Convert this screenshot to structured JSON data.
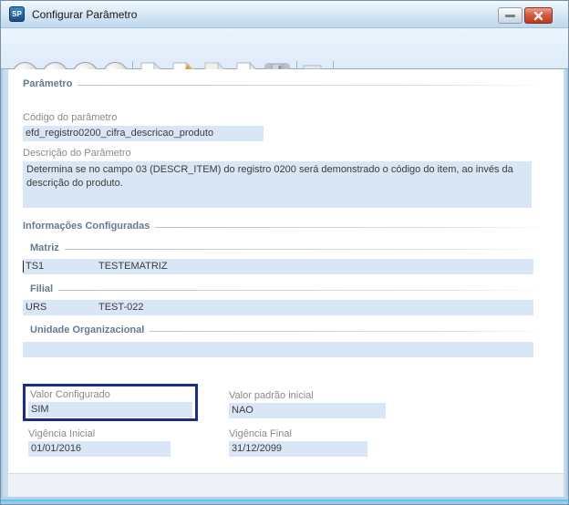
{
  "colors": {
    "annotation_box": "#1b2c90",
    "field_background": "#d9e6f5",
    "close_button_red": "#c8432c",
    "toolbar_background": "#e3eefb",
    "section_header_text": "#66798f"
  },
  "window": {
    "title": "Configurar Parâmetro",
    "icon_text": "SP"
  },
  "toolbar_icons": [
    "first-record-icon",
    "previous-record-icon",
    "next-record-icon",
    "last-record-icon",
    "new-document-icon",
    "edit-pencil-icon",
    "undo-arrow-icon",
    "cancel-red-x-icon",
    "save-floppy-icon",
    "lock-icon"
  ],
  "parametro": {
    "section_title": "Parâmetro",
    "codigo": {
      "label": "Código do parâmetro",
      "value": "efd_registro0200_cifra_descricao_produto"
    },
    "descricao": {
      "label": "Descrição do Parâmetro",
      "value": "Determina se no campo 03 (DESCR_ITEM) do registro 0200 será demonstrado o código do item, ao invés da descrição do produto."
    }
  },
  "informacoes": {
    "section_title": "Informações Configuradas",
    "matriz": {
      "title": "Matriz",
      "code": "TS1",
      "name": "TESTEMATRIZ"
    },
    "filial": {
      "title": "Filial",
      "code": "URS",
      "name": "TEST-022"
    },
    "unidade": {
      "title": "Unidade Organizacional",
      "code": "",
      "name": ""
    },
    "valor_configurado": {
      "label": "Valor Configurado",
      "value": "SIM"
    },
    "valor_padrao": {
      "label": "Valor padrão inicial",
      "value": "NAO"
    },
    "vigencia_inicial": {
      "label": "Vigência Inicial",
      "value": "01/01/2016"
    },
    "vigencia_final": {
      "label": "Vigência Final",
      "value": "31/12/2099"
    }
  }
}
